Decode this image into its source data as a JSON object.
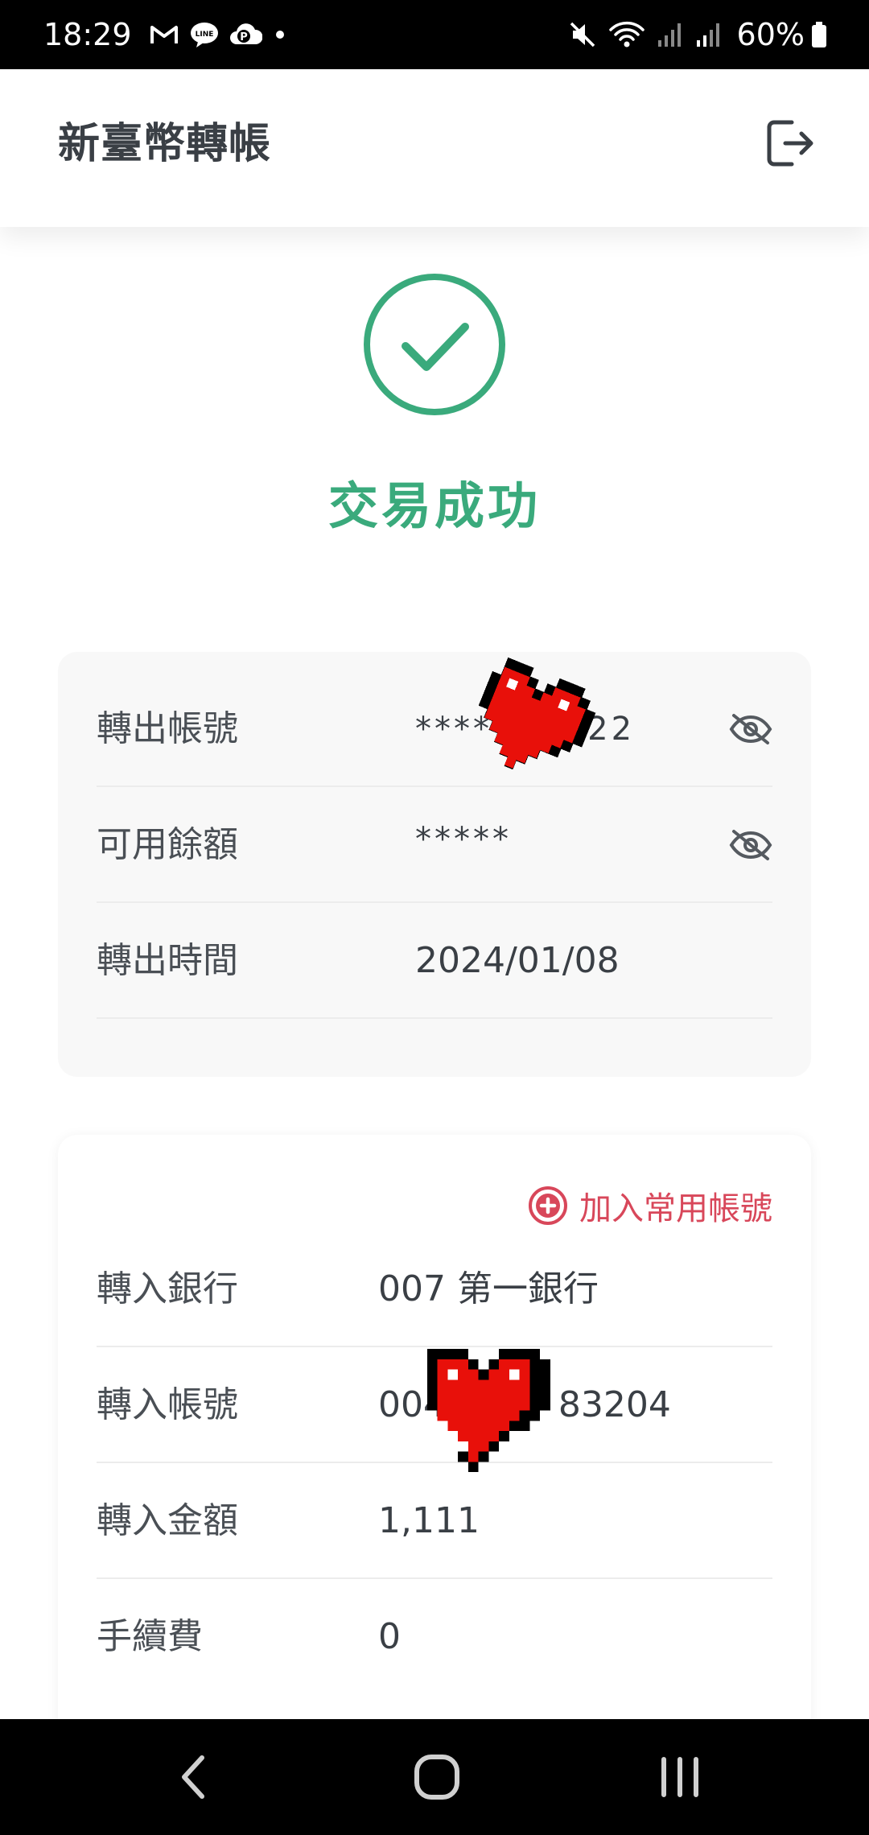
{
  "status_bar": {
    "time": "18:29",
    "battery_percent": "60%",
    "icons": [
      "gmail-icon",
      "line-icon",
      "parking-app-icon",
      "dot-icon",
      "mute-icon",
      "wifi-icon",
      "signal-icon",
      "signal-icon",
      "battery-icon"
    ]
  },
  "header": {
    "title": "新臺幣轉帳",
    "action_icon": "logout-icon"
  },
  "result": {
    "icon": "check-circle-icon",
    "title": "交易成功",
    "accent_color": "#3aaa7c"
  },
  "source": {
    "rows": [
      {
        "label": "轉出帳號",
        "value": "*******  422",
        "toggle_icon": "eye-off-icon"
      },
      {
        "label": "可用餘額",
        "value": "*****",
        "toggle_icon": "eye-off-icon"
      },
      {
        "label": "轉出時間",
        "value": "2024/01/08"
      }
    ]
  },
  "destination": {
    "add_favorite_label": "加入常用帳號",
    "add_favorite_icon": "plus-circle-icon",
    "add_favorite_color": "#d8475a",
    "rows": [
      {
        "label": "轉入銀行",
        "value": "007 第一銀行"
      },
      {
        "label": "轉入帳號",
        "value": "0041        83204"
      },
      {
        "label": "轉入金額",
        "value": "1,111"
      },
      {
        "label": "手續費",
        "value": "0"
      }
    ]
  },
  "nav_bar": {
    "icons": [
      "back-icon",
      "home-icon",
      "recents-icon"
    ]
  }
}
